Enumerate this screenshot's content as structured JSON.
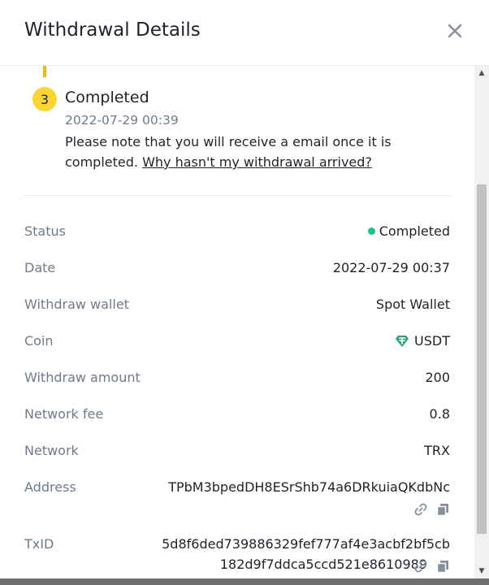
{
  "dialog": {
    "title": "Withdrawal Details"
  },
  "step": {
    "number": "3",
    "title": "Completed",
    "time": "2022-07-29 00:39",
    "note": "Please note that you will receive a email once it is completed.",
    "link": "Why hasn't my withdrawal arrived?"
  },
  "details": {
    "status_label": "Status",
    "status_value": "Completed",
    "date_label": "Date",
    "date_value": "2022-07-29 00:37",
    "wallet_label": "Withdraw wallet",
    "wallet_value": "Spot Wallet",
    "coin_label": "Coin",
    "coin_value": "USDT",
    "amount_label": "Withdraw amount",
    "amount_value": "200",
    "fee_label": "Network fee",
    "fee_value": "0.8",
    "network_label": "Network",
    "network_value": "TRX",
    "address_label": "Address",
    "address_value": "TPbM3bpedDH8ESrShb74a6DRkuiaQKdbNc",
    "txid_label": "TxID",
    "txid_line1": "5d8f6ded739886329fef777af4e3acbf2bf5cb",
    "txid_line2": "182d9f7ddca5ccd521e8610989"
  },
  "icons": {
    "close": "close-icon",
    "coin": "tether-icon",
    "link": "link-icon",
    "copy": "copy-icon"
  },
  "colors": {
    "accent": "#fcd535",
    "success": "#0ecb81",
    "tether": "#26a17b",
    "text_secondary": "#707a8a"
  }
}
